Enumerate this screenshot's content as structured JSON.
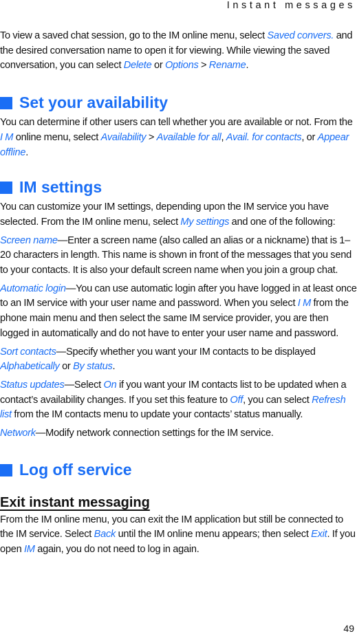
{
  "header": {
    "running_title": "Instant messages"
  },
  "intro": {
    "t1": "To view a saved chat session, go to the IM online menu, select ",
    "l1": "Saved convers.",
    "t2": " and the desired conversation name to open it for viewing. While viewing the saved conversation, you can select ",
    "l2": "Delete",
    "t3": " or ",
    "l3": "Options",
    "t4": " > ",
    "l4": "Rename",
    "t5": "."
  },
  "availability": {
    "title": "Set your availability",
    "t1": "You can determine if other users can tell whether you are available or not. From the ",
    "l1": "I M",
    "t2": " online menu, select ",
    "l2": "Availability",
    "t3": " > ",
    "l3": "Available for all",
    "t4": ", ",
    "l4": "Avail. for contacts",
    "t5": ", or ",
    "l5": "Appear offline",
    "t6": "."
  },
  "im_settings": {
    "title": "IM settings",
    "intro_t1": "You can customize your IM settings, depending upon the IM service you have selected. From the IM online menu, select ",
    "intro_l1": "My settings",
    "intro_t2": " and one of the following:",
    "screen_name": {
      "term": "Screen name",
      "text": "—Enter a screen name (also called an alias or a nickname) that is 1–20 characters in length. This name is shown in front of the messages that you send to your contacts. It is also your default screen name when you join a group chat."
    },
    "automatic_login": {
      "term": "Automatic login",
      "t1": "—You can use automatic login after you have logged in at least once to an IM service with your user name and password. When you select ",
      "l1": "I M",
      "t2": " from the phone main menu and then select the same IM service provider, you are then logged in automatically and do not have to enter your user name and password."
    },
    "sort_contacts": {
      "term": "Sort contacts",
      "t1": "—Specify whether you want your IM contacts to be displayed ",
      "l1": "Alphabetically",
      "t2": " or ",
      "l2": "By status",
      "t3": "."
    },
    "status_updates": {
      "term": "Status updates",
      "t1": "—Select ",
      "l1": "On",
      "t2": " if you want your IM contacts list to be updated when a contact’s availability changes. If you set this feature to ",
      "l2": "Off",
      "t3": ", you can select ",
      "l3": "Refresh list",
      "t4": " from the IM contacts menu to update your contacts’ status manually."
    },
    "network": {
      "term": "Network",
      "text": "—Modify network connection settings for the IM service."
    }
  },
  "log_off": {
    "title": "Log off service",
    "subtitle": "Exit instant messaging",
    "t1": "From the IM online menu, you can exit the IM application but still be connected to the IM service. Select ",
    "l1": "Back",
    "t2": " until the IM online menu appears; then select ",
    "l2": "Exit",
    "t3": ". If you open ",
    "l3": "IM",
    "t4": " again, you do not need to log in again."
  },
  "footer": {
    "page_number": "49"
  },
  "colors": {
    "accent": "#1a6ef5",
    "text": "#111111"
  }
}
